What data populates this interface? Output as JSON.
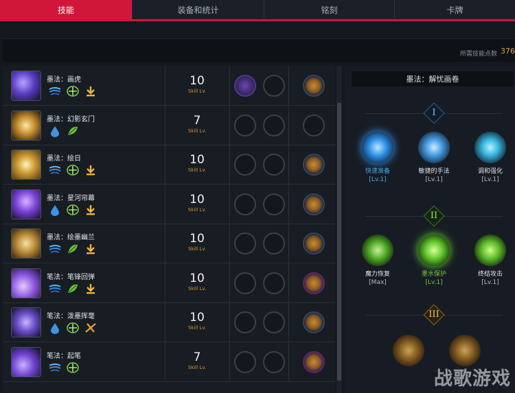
{
  "tabs": [
    {
      "label": "技能",
      "active": true
    },
    {
      "label": "装备和统计",
      "active": false
    },
    {
      "label": "铭刻",
      "active": false
    },
    {
      "label": "卡牌",
      "active": false
    }
  ],
  "points": {
    "label": "所需技能点数",
    "value": "376"
  },
  "lv_caption": "Skill Lv.",
  "skills": [
    {
      "name": "墨法：画虎",
      "level": "10",
      "mods": [
        "blue-wave",
        "green-cross",
        "gold-arrow"
      ],
      "slots": [
        "filled",
        "empty",
        "rune"
      ]
    },
    {
      "name": "墨法：幻影玄门",
      "level": "7",
      "mods": [
        "blue-drop",
        "green-leaf"
      ],
      "slots": [
        "empty",
        "empty",
        "empty"
      ]
    },
    {
      "name": "墨法：绘日",
      "level": "10",
      "mods": [
        "blue-wave",
        "green-cross",
        "gold-arrow"
      ],
      "slots": [
        "empty",
        "empty",
        "rune"
      ]
    },
    {
      "name": "墨法：星河帘幕",
      "level": "10",
      "mods": [
        "blue-drop",
        "green-cross",
        "gold-arrow"
      ],
      "slots": [
        "empty",
        "empty",
        "rune"
      ]
    },
    {
      "name": "墨法：绘墨幽兰",
      "level": "10",
      "mods": [
        "blue-wave",
        "green-leaf",
        "gold-arrow"
      ],
      "slots": [
        "empty",
        "empty",
        "rune"
      ]
    },
    {
      "name": "笔法：笔锋回弹",
      "level": "10",
      "mods": [
        "blue-wave",
        "green-leaf",
        "gold-arrow"
      ],
      "slots": [
        "empty",
        "empty",
        "rune-purple"
      ]
    },
    {
      "name": "笔法：泼墨挥毫",
      "level": "10",
      "mods": [
        "blue-drop",
        "green-cross",
        "gold-cross"
      ],
      "slots": [
        "empty",
        "empty",
        "rune"
      ]
    },
    {
      "name": "笔法：起笔",
      "level": "7",
      "mods": [
        "blue-wave",
        "green-cross"
      ],
      "slots": [
        "empty",
        "empty",
        "rune-purple"
      ]
    }
  ],
  "detail": {
    "title": "墨法：解忧画卷",
    "tiers": [
      {
        "label": "I",
        "nodes": [
          {
            "name": "快速准备",
            "lv": "[Lv.1]",
            "state": "selected-blue",
            "icon": "quick-prep-icon"
          },
          {
            "name": "敏捷的手法",
            "lv": "[Lv.1]",
            "state": "normal",
            "icon": "agile-hand-icon"
          },
          {
            "name": "调和强化",
            "lv": "[Lv.1]",
            "state": "normal",
            "icon": "harmony-icon"
          }
        ]
      },
      {
        "label": "II",
        "nodes": [
          {
            "name": "魔力恢复",
            "lv": "[Max]",
            "state": "normal",
            "icon": "mana-recover-icon"
          },
          {
            "name": "墨水保护",
            "lv": "[Lv.1]",
            "state": "selected-green",
            "icon": "ink-protect-icon"
          },
          {
            "name": "终结攻击",
            "lv": "[Lv.1]",
            "state": "normal",
            "icon": "finish-attack-icon"
          }
        ]
      },
      {
        "label": "III",
        "nodes": []
      }
    ]
  },
  "watermark": "战歌游戏"
}
